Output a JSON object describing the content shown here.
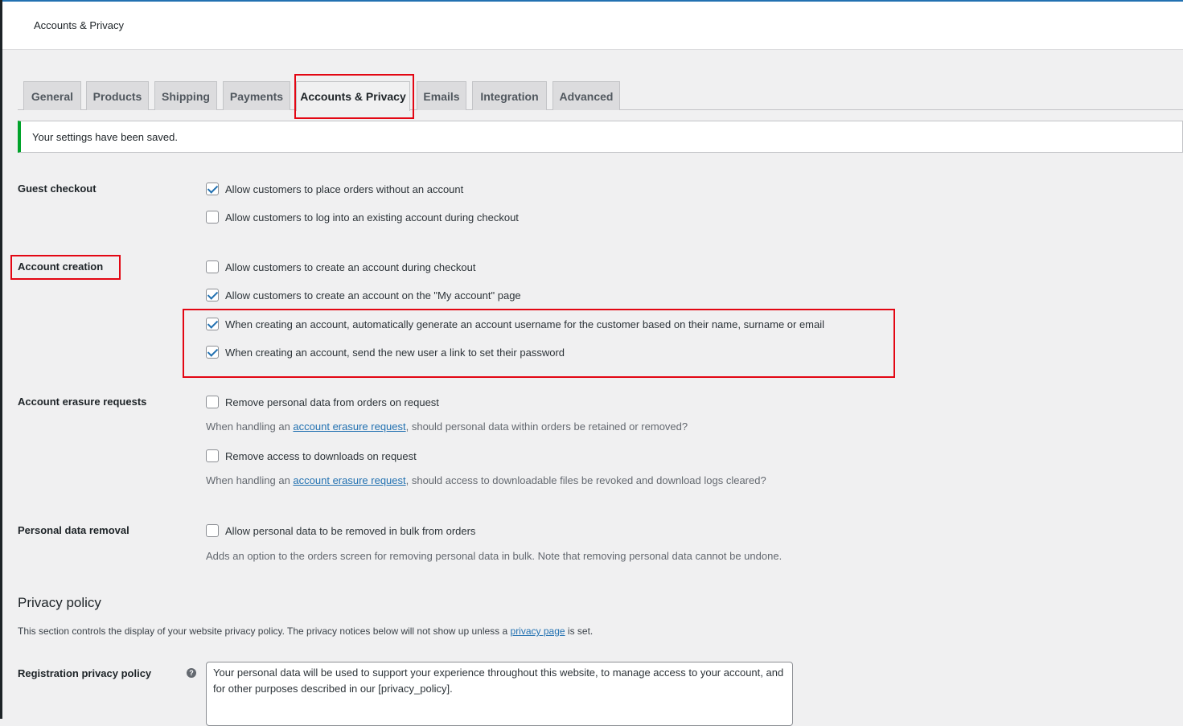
{
  "header": {
    "title": "Accounts & Privacy"
  },
  "tabs": [
    {
      "label": "General"
    },
    {
      "label": "Products"
    },
    {
      "label": "Shipping"
    },
    {
      "label": "Payments"
    },
    {
      "label": "Accounts & Privacy",
      "active": true
    },
    {
      "label": "Emails"
    },
    {
      "label": "Integration"
    },
    {
      "label": "Advanced"
    }
  ],
  "notice": {
    "text": "Your settings have been saved."
  },
  "guest_checkout": {
    "label": "Guest checkout",
    "options": [
      {
        "text": "Allow customers to place orders without an account",
        "checked": true
      },
      {
        "text": "Allow customers to log into an existing account during checkout",
        "checked": false
      }
    ]
  },
  "account_creation": {
    "label": "Account creation",
    "options": [
      {
        "text": "Allow customers to create an account during checkout",
        "checked": false
      },
      {
        "text": "Allow customers to create an account on the \"My account\" page",
        "checked": true
      },
      {
        "text": "When creating an account, automatically generate an account username for the customer based on their name, surname or email",
        "checked": true
      },
      {
        "text": "When creating an account, send the new user a link to set their password",
        "checked": true
      }
    ]
  },
  "erasure": {
    "label": "Account erasure requests",
    "options": [
      {
        "text": "Remove personal data from orders on request",
        "checked": false
      },
      {
        "text": "Remove access to downloads on request",
        "checked": false
      }
    ],
    "desc1_pre": "When handling an ",
    "desc1_link": "account erasure request",
    "desc1_post": ", should personal data within orders be retained or removed?",
    "desc2_pre": "When handling an ",
    "desc2_link": "account erasure request",
    "desc2_post": ", should access to downloadable files be revoked and download logs cleared?"
  },
  "personal_removal": {
    "label": "Personal data removal",
    "option": {
      "text": "Allow personal data to be removed in bulk from orders",
      "checked": false
    },
    "desc": "Adds an option to the orders screen for removing personal data in bulk. Note that removing personal data cannot be undone."
  },
  "privacy_policy": {
    "title": "Privacy policy",
    "desc_pre": "This section controls the display of your website privacy policy. The privacy notices below will not show up unless a ",
    "desc_link": "privacy page",
    "desc_post": " is set.",
    "registration_label": "Registration privacy policy",
    "help_icon": "?",
    "registration_text": "Your personal data will be used to support your experience throughout this website, to manage access to your account, and for other purposes described in our [privacy_policy]."
  },
  "colors": {
    "accent": "#2271b1",
    "success": "#00a32a",
    "highlight": "#e30613"
  }
}
